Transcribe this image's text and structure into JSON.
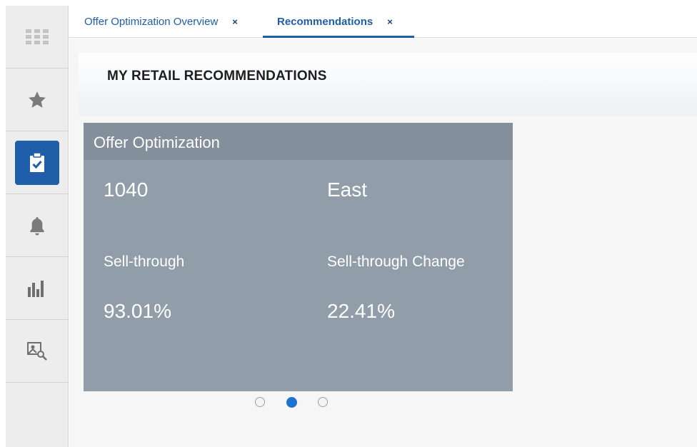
{
  "tabs": [
    {
      "label": "Offer Optimization Overview",
      "close": "×"
    },
    {
      "label": "Recommendations",
      "close": "×"
    }
  ],
  "page": {
    "title": "MY RETAIL RECOMMENDATIONS"
  },
  "rail": {
    "icons": [
      "apps-grid-icon",
      "star-icon",
      "clipboard-check-icon",
      "bell-icon",
      "bar-chart-icon",
      "image-search-icon"
    ],
    "active_index": 2,
    "accent": "#1f5ea8"
  },
  "card": {
    "title": "Offer Optimization",
    "id": "1040",
    "region": "East",
    "metric1_label": "Sell-through",
    "metric1_value": "93.01%",
    "metric2_label": "Sell-through Change",
    "metric2_value": "22.41%"
  },
  "pager": {
    "count": 3,
    "active": 2
  }
}
